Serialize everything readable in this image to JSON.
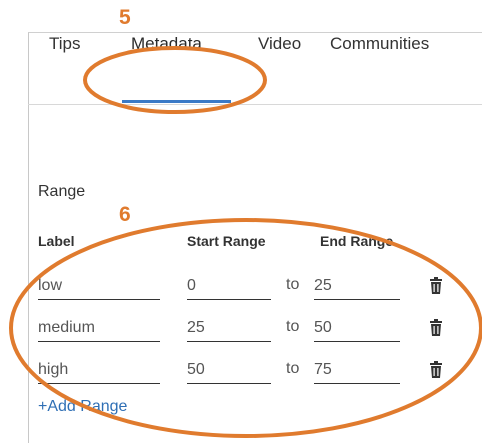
{
  "annotations": {
    "tabs_marker": "5",
    "range_marker": "6",
    "accent_color": "#e07b2e"
  },
  "tabs": [
    {
      "label": "Tips",
      "active": false
    },
    {
      "label": "Metadata",
      "active": true
    },
    {
      "label": "Video",
      "active": false
    },
    {
      "label": "Communities",
      "active": false
    }
  ],
  "range": {
    "title": "Range",
    "columns": {
      "label": "Label",
      "start": "Start Range",
      "end": "End Range"
    },
    "separator": "to",
    "rows": [
      {
        "label": "low",
        "start": "0",
        "end": "25"
      },
      {
        "label": "medium",
        "start": "25",
        "end": "50"
      },
      {
        "label": "high",
        "start": "50",
        "end": "75"
      }
    ],
    "add_label": "+Add Range"
  },
  "icons": {
    "delete": "trash-icon"
  },
  "colors": {
    "tab_underline": "#3b7ac6",
    "link": "#2f6fb5"
  }
}
